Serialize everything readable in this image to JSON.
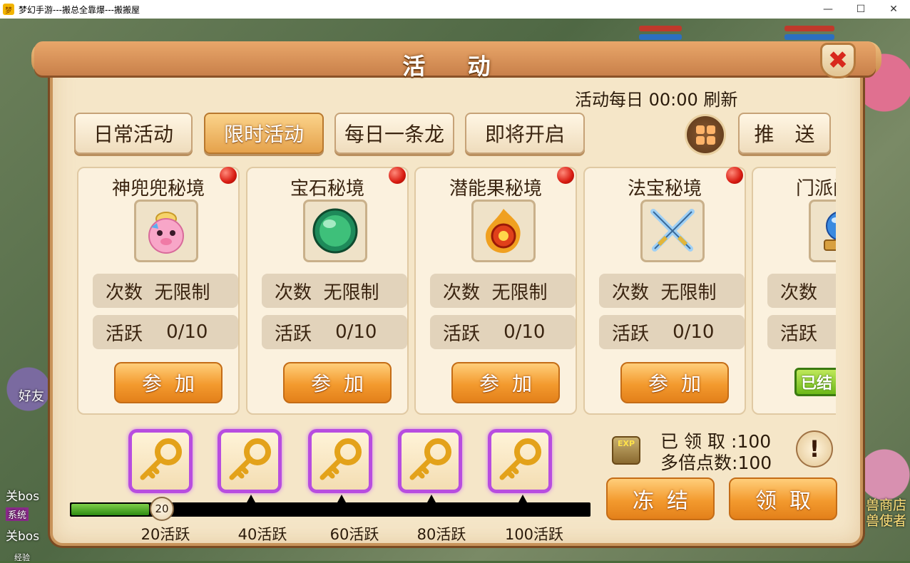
{
  "window": {
    "title": "梦幻手游---搬总全靠爆---搬搬屋",
    "minimize": "—",
    "maximize": "☐",
    "close": "✕"
  },
  "background": {
    "left_labels": [
      "好友",
      "关bos",
      "系统",
      "关bos",
      "经验"
    ],
    "right_labels": [
      "兽商店",
      "兽使者"
    ]
  },
  "panel": {
    "title": "活 动",
    "close_icon": "✖",
    "refresh_text": "活动每日 00:00 刷新"
  },
  "tabs": [
    {
      "label": "日常活动",
      "active": false
    },
    {
      "label": "限时活动",
      "active": true
    },
    {
      "label": "每日一条龙",
      "active": false
    },
    {
      "label": "即将开启",
      "active": false
    }
  ],
  "push_button": "推 送",
  "cards": [
    {
      "title": "神兜兜秘境",
      "icon": "pink-pig-icon",
      "count_label": "次数",
      "count_value": "无限制",
      "active_label": "活跃",
      "active_value": "0/10",
      "button": "参加"
    },
    {
      "title": "宝石秘境",
      "icon": "green-orb-icon",
      "count_label": "次数",
      "count_value": "无限制",
      "active_label": "活跃",
      "active_value": "0/10",
      "button": "参加"
    },
    {
      "title": "潜能果秘境",
      "icon": "fire-orb-icon",
      "count_label": "次数",
      "count_value": "无限制",
      "active_label": "活跃",
      "active_value": "0/10",
      "button": "参加"
    },
    {
      "title": "法宝秘境",
      "icon": "crossed-swords-icon",
      "count_label": "次数",
      "count_value": "无限制",
      "active_label": "活跃",
      "active_value": "0/10",
      "button": "参加"
    },
    {
      "title": "门派闯关",
      "icon": "crystal-ball-icon",
      "count_label": "次数",
      "count_value": "",
      "active_label": "活跃",
      "active_value": "",
      "badge": "已结"
    }
  ],
  "rewards": {
    "progress_value": 20,
    "progress_fraction": 0.15,
    "milestones": [
      "20活跃",
      "40活跃",
      "60活跃",
      "80活跃",
      "100活跃"
    ],
    "key_icon": "gold-key-icon"
  },
  "stats": {
    "claimed_label": "已领取",
    "claimed_value": ":100",
    "multi_label": "多倍点数",
    "multi_value": ":100",
    "exp_icon_text": "EXP"
  },
  "buttons": {
    "freeze": "冻结",
    "claim": "领取"
  },
  "colors": {
    "accent": "#f39a2e",
    "active_tab": "#e5a24c",
    "progress": "#3a9a18",
    "key_border": "#b84de0"
  }
}
